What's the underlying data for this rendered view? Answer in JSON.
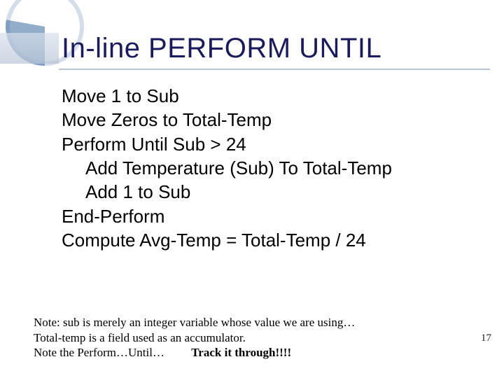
{
  "title": "In-line PERFORM UNTIL",
  "code": {
    "l1": "Move 1 to Sub",
    "l2": "Move Zeros to Total-Temp",
    "l3": "Perform Until Sub > 24",
    "l4": "Add Temperature (Sub) To Total-Temp",
    "l5": "Add 1 to Sub",
    "l6": "End-Perform",
    "l7": "Compute Avg-Temp = Total-Temp / 24"
  },
  "note": {
    "line1": "Note:  sub is merely an integer variable whose value we are using…",
    "line2": "Total-temp is a field used as an accumulator.",
    "line3_part1": "Note the Perform…Until…         ",
    "line3_part2": "Track it through!!!!"
  },
  "page_number": "17"
}
